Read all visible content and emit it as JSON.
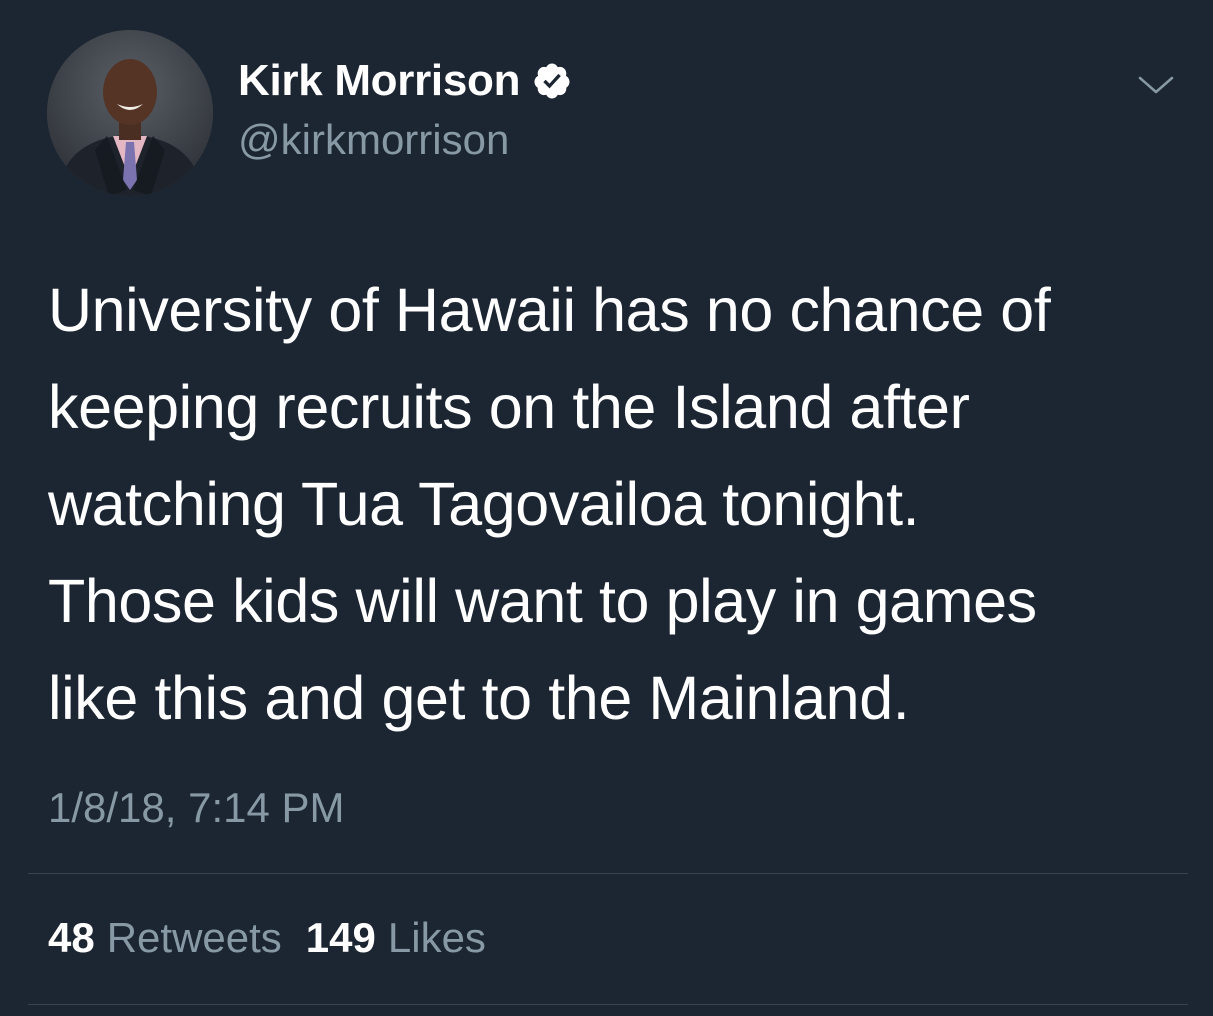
{
  "tweet": {
    "author": {
      "display_name": "Kirk Morrison",
      "handle": "@kirkmorrison",
      "verified": true
    },
    "text_lines": [
      "University of Hawaii has no chance of",
      "keeping recruits on the Island after",
      "watching Tua Tagovailoa tonight.",
      "Those kids will want to play in games",
      "like this and get to the Mainland."
    ],
    "timestamp": "1/8/18, 7:14 PM",
    "stats": {
      "retweets_count": "48",
      "retweets_label": "Retweets",
      "likes_count": "149",
      "likes_label": "Likes"
    }
  },
  "icons": {
    "verified": "verified-badge-icon",
    "caret": "chevron-down-icon"
  },
  "colors": {
    "background": "#1c2532",
    "primary_text": "#ffffff",
    "secondary_text": "#8899a6",
    "divider": "#38444d"
  }
}
